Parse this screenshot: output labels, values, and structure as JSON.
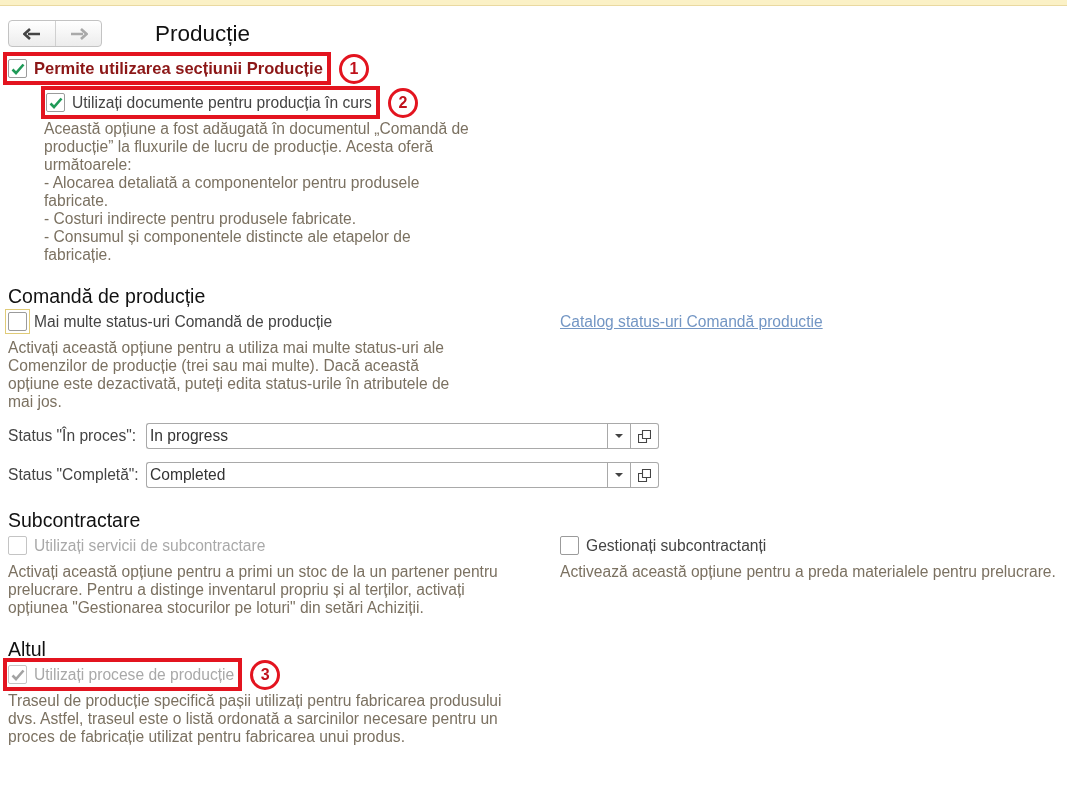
{
  "nav_buttons": [
    {
      "kind": "back",
      "disabled": false
    },
    {
      "kind": "forward",
      "disabled": true
    }
  ],
  "title": "Producție",
  "main_option": {
    "label": "Permite utilizarea secțiunii Producție",
    "checked": true,
    "disabled": false,
    "focused": false,
    "callout": "1",
    "children": [
      {
        "label": "Utilizați documente pentru producția în curs",
        "checked": true,
        "disabled": false,
        "focused": false,
        "callout": "2",
        "description": "Această opțiune a fost adăugată în documentul „Comandă de producție” la fluxurile de lucru de producție. Acesta oferă următoarele:\n- Alocarea detaliată a componentelor pentru produsele fabricate.\n- Costuri indirecte pentru produsele fabricate.\n- Consumul și componentele distincte ale etapelor de fabricație."
      }
    ]
  },
  "sections": [
    {
      "heading": "Comandă de producție",
      "options": [
        {
          "label": "Mai multe status-uri Comandă de producție",
          "checked": false,
          "disabled": false,
          "focused": true,
          "description": "Activați această opțiune pentru a utiliza mai multe status-uri ale Comenzilor de producție (trei sau mai multe). Dacă această opțiune este dezactivată, puteți edita status-urile în atributele de mai jos."
        }
      ],
      "link": "Catalog status-uri Comandă productie",
      "fields": [
        {
          "label": "Status \"În proces\":",
          "value": "In progress"
        },
        {
          "label": "Status \"Completă\":",
          "value": "Completed"
        }
      ]
    },
    {
      "heading": "Subcontractare",
      "options": [
        {
          "label": "Utilizați servicii de subcontractare",
          "checked": false,
          "disabled": true,
          "focused": false,
          "description": "Activați această opțiune pentru a primi un stoc de la un partener pentru prelucrare. Pentru a distinge inventarul propriu și al terților, activați opțiunea \"Gestionarea stocurilor pe loturi\" din setări Achiziții."
        },
        {
          "label": "Gestionați subcontractanți",
          "checked": false,
          "disabled": false,
          "focused": false,
          "description": "Activează această opțiune pentru a preda materialele pentru prelucrare."
        }
      ]
    },
    {
      "heading": "Altul",
      "options": [
        {
          "label": "Utilizați procese de producție",
          "checked": true,
          "disabled": true,
          "focused": false,
          "callout": "3",
          "description": "Traseul de producție specifică pașii utilizați pentru fabricarea produsului dvs. Astfel, traseul este o listă ordonată a sarcinilor necesare pentru un proces de fabricație utilizat pentru fabricarea unui produs."
        }
      ]
    }
  ]
}
